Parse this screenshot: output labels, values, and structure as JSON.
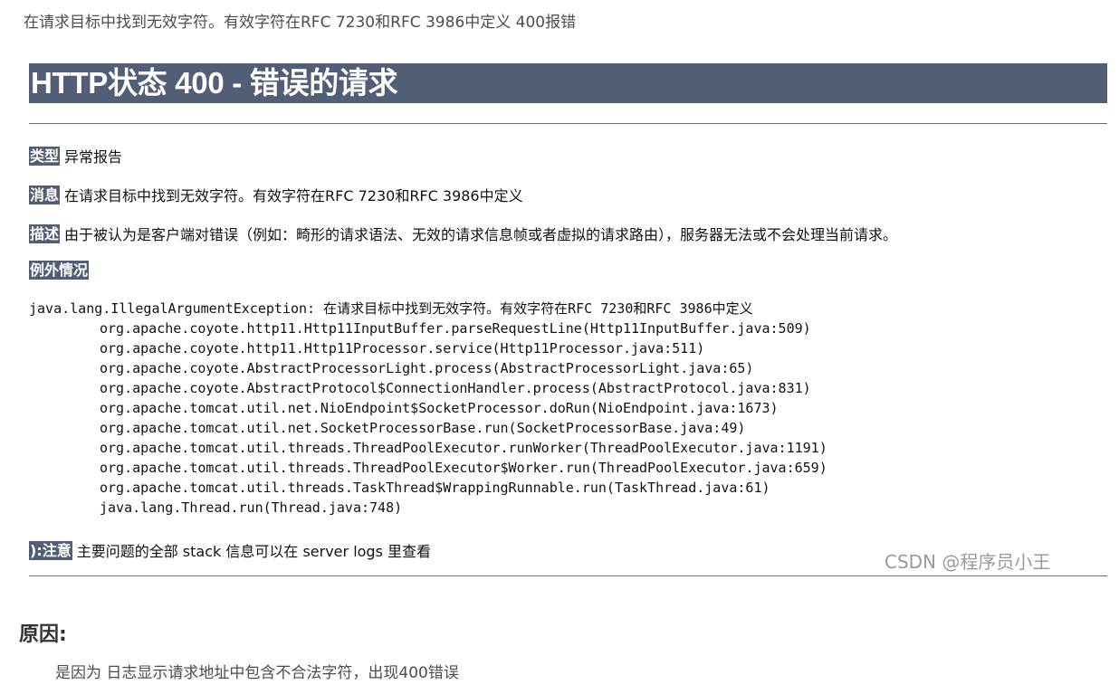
{
  "intro_text": "在请求目标中找到无效字符。有效字符在RFC 7230和RFC 3986中定义  400报错",
  "error_page": {
    "title": "HTTP状态 400 - 错误的请求",
    "type_label": "类型",
    "type_value": "异常报告",
    "message_label": "消息",
    "message_value": "在请求目标中找到无效字符。有效字符在RFC 7230和RFC 3986中定义",
    "description_label": "描述",
    "description_value": "由于被认为是客户端对错误（例如：畸形的请求语法、无效的请求信息帧或者虚拟的请求路由），服务器无法或不会处理当前请求。",
    "exception_label": "例外情况",
    "exception_head": "java.lang.IllegalArgumentException: 在请求目标中找到无效字符。有效字符在RFC 7230和RFC 3986中定义",
    "stack_frames": [
      "org.apache.coyote.http11.Http11InputBuffer.parseRequestLine(Http11InputBuffer.java:509)",
      "org.apache.coyote.http11.Http11Processor.service(Http11Processor.java:511)",
      "org.apache.coyote.AbstractProcessorLight.process(AbstractProcessorLight.java:65)",
      "org.apache.coyote.AbstractProtocol$ConnectionHandler.process(AbstractProtocol.java:831)",
      "org.apache.tomcat.util.net.NioEndpoint$SocketProcessor.doRun(NioEndpoint.java:1673)",
      "org.apache.tomcat.util.net.SocketProcessorBase.run(SocketProcessorBase.java:49)",
      "org.apache.tomcat.util.threads.ThreadPoolExecutor.runWorker(ThreadPoolExecutor.java:1191)",
      "org.apache.tomcat.util.threads.ThreadPoolExecutor$Worker.run(ThreadPoolExecutor.java:659)",
      "org.apache.tomcat.util.threads.TaskThread$WrappingRunnable.run(TaskThread.java:61)",
      "java.lang.Thread.run(Thread.java:748)"
    ],
    "note_label": "):注意",
    "note_value": "主要问题的全部 stack 信息可以在 server logs 里查看",
    "watermark": "CSDN @程序员小王"
  },
  "cause": {
    "heading": "原因:",
    "text": "是因为 日志显示请求地址中包含不合法字符，出现400错误"
  },
  "colors": {
    "tomcat_header": "#525d76",
    "rule": "#6d6d6d",
    "watermark": "#9a9a9a"
  }
}
